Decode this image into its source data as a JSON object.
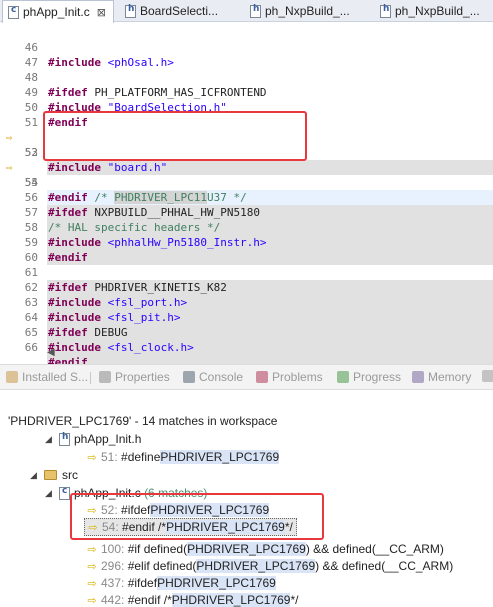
{
  "editor_tabs": [
    {
      "label": "phApp_Init.c",
      "icon": "c-file-icon",
      "active": true
    },
    {
      "label": "BoardSelecti...",
      "icon": "h-file-icon",
      "active": false
    },
    {
      "label": "ph_NxpBuild_...",
      "icon": "h-file-icon",
      "active": false
    },
    {
      "label": "ph_NxpBuild_...",
      "icon": "h-file-icon",
      "active": false
    }
  ],
  "tab_close_glyph": "⊠",
  "code_lines": [
    {
      "n": "46",
      "text": "#include <phOsal.h>"
    },
    {
      "n": "47",
      "text": ""
    },
    {
      "n": "48",
      "text": "#ifdef PH_PLATFORM_HAS_ICFRONTEND"
    },
    {
      "n": "49",
      "text": "#include \"BoardSelection.h\""
    },
    {
      "n": "50",
      "text": "#endif"
    },
    {
      "n": "51",
      "text": ""
    },
    {
      "n": "52",
      "text": "#ifdef PHDRIVER_LPC11U37"
    },
    {
      "n": "53",
      "text": "#include \"board.h\""
    },
    {
      "n": "54",
      "text": "#endif /* PHDRIVER_LPC11U37 */"
    },
    {
      "n": "55",
      "text": ""
    },
    {
      "n": "56",
      "text": "#ifdef NXPBUILD__PHHAL_HW_PN5180"
    },
    {
      "n": "57",
      "text": "/* HAL specific headers */"
    },
    {
      "n": "58",
      "text": "#include <phhalHw_Pn5180_Instr.h>"
    },
    {
      "n": "59",
      "text": "#endif"
    },
    {
      "n": "60",
      "text": ""
    },
    {
      "n": "61",
      "text": "#ifdef PHDRIVER_KINETIS_K82"
    },
    {
      "n": "62",
      "text": "#include <fsl_port.h>"
    },
    {
      "n": "63",
      "text": "#include <fsl_pit.h>"
    },
    {
      "n": "64",
      "text": "#ifdef DEBUG"
    },
    {
      "n": "65",
      "text": "#include <fsl_clock.h>"
    },
    {
      "n": "66",
      "text": "#endif"
    }
  ],
  "view_tabs": [
    {
      "label": "Installed S...",
      "icon": "installed-software-icon",
      "color": "#c99a4a"
    },
    {
      "label": "Properties",
      "icon": "properties-icon",
      "color": "#8a8a8a"
    },
    {
      "label": "Console",
      "icon": "console-icon",
      "color": "#556677"
    },
    {
      "label": "Problems",
      "icon": "problems-icon",
      "color": "#b03a5a"
    },
    {
      "label": "Progress",
      "icon": "progress-icon",
      "color": "#4a9a4a"
    },
    {
      "label": "Memory",
      "icon": "memory-icon",
      "color": "#7a6aa0"
    }
  ],
  "search": {
    "title": "'PHDRIVER_LPC1769' - 14 matches in workspace",
    "file1": "phApp_Init.h",
    "m51_line": "51:",
    "m51_pre": "#define ",
    "term": "PHDRIVER_LPC1769",
    "folder": "src",
    "file2": "phApp_Init.c",
    "file2_count": "(6 matches)",
    "m52_line": "52:",
    "m52_pre": "#ifdef ",
    "m54_line": "54:",
    "m54_pre": "#endif /* ",
    "m54_post": " */",
    "m100_line": "100:",
    "m100_pre": "#if defined(",
    "m100_post": ") && defined(__CC_ARM)",
    "m296_line": "296:",
    "m296_pre": "#elif defined(",
    "m296_post": ") && defined(__CC_ARM)",
    "m437_line": "437:",
    "m437_pre": "#ifdef ",
    "m442_line": "442:",
    "m442_pre": "#endif /* ",
    "m442_post": " */"
  }
}
